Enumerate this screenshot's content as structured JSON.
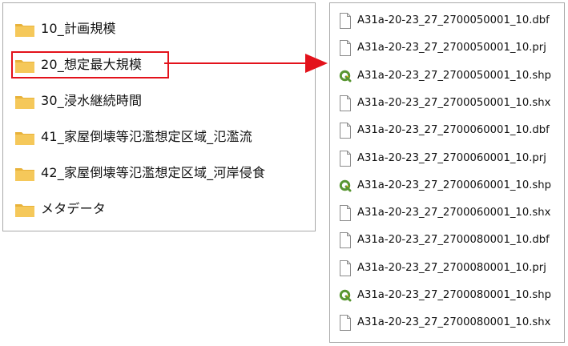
{
  "left_pane": {
    "folders": [
      {
        "label": "10_計画規模",
        "icon": "folder-icon"
      },
      {
        "label": "20_想定最大規模",
        "icon": "folder-icon",
        "highlighted": true
      },
      {
        "label": "30_浸水継続時間",
        "icon": "folder-icon"
      },
      {
        "label": "41_家屋倒壊等氾濫想定区域_氾濫流",
        "icon": "folder-icon"
      },
      {
        "label": "42_家屋倒壊等氾濫想定区域_河岸侵食",
        "icon": "folder-icon"
      },
      {
        "label": "メタデータ",
        "icon": "folder-icon"
      }
    ]
  },
  "right_pane": {
    "files": [
      {
        "name": "A31a-20-23_27_2700050001_10.dbf",
        "icon": "blank-file-icon"
      },
      {
        "name": "A31a-20-23_27_2700050001_10.prj",
        "icon": "blank-file-icon"
      },
      {
        "name": "A31a-20-23_27_2700050001_10.shp",
        "icon": "qgis-icon"
      },
      {
        "name": "A31a-20-23_27_2700050001_10.shx",
        "icon": "blank-file-icon"
      },
      {
        "name": "A31a-20-23_27_2700060001_10.dbf",
        "icon": "blank-file-icon"
      },
      {
        "name": "A31a-20-23_27_2700060001_10.prj",
        "icon": "blank-file-icon"
      },
      {
        "name": "A31a-20-23_27_2700060001_10.shp",
        "icon": "qgis-icon"
      },
      {
        "name": "A31a-20-23_27_2700060001_10.shx",
        "icon": "blank-file-icon"
      },
      {
        "name": "A31a-20-23_27_2700080001_10.dbf",
        "icon": "blank-file-icon"
      },
      {
        "name": "A31a-20-23_27_2700080001_10.prj",
        "icon": "blank-file-icon"
      },
      {
        "name": "A31a-20-23_27_2700080001_10.shp",
        "icon": "qgis-icon"
      },
      {
        "name": "A31a-20-23_27_2700080001_10.shx",
        "icon": "blank-file-icon"
      }
    ]
  },
  "colors": {
    "highlight": "#e3121b",
    "arrow": "#e3121b",
    "folder": "#f5c342",
    "qgis_green": "#589632",
    "qgis_yellow": "#f0b21b"
  }
}
